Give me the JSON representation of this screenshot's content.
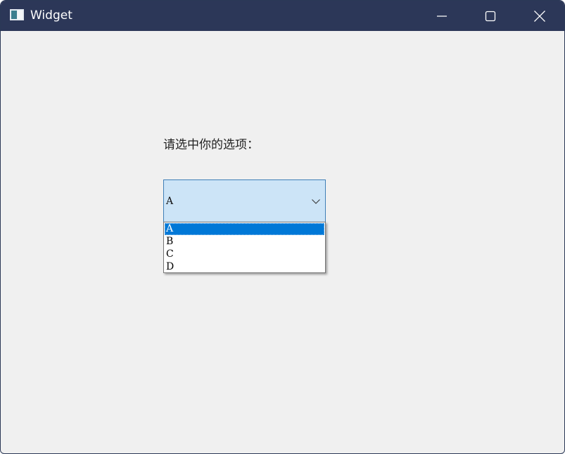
{
  "window": {
    "title": "Widget",
    "icon": "app-window-icon",
    "controls": {
      "minimize": "minimize-icon",
      "maximize": "maximize-icon",
      "close": "close-icon"
    }
  },
  "content": {
    "label": "请选中你的选项：",
    "combo": {
      "selected_value": "A",
      "arrow_icon": "chevron-down-icon",
      "options": [
        "A",
        "B",
        "C",
        "D"
      ],
      "highlighted_index": 0
    }
  },
  "colors": {
    "titlebar": "#2c3758",
    "window_bg": "#f0f0f0",
    "combo_bg": "#cce4f7",
    "combo_border": "#3f7fb7",
    "selection": "#0078d7"
  }
}
